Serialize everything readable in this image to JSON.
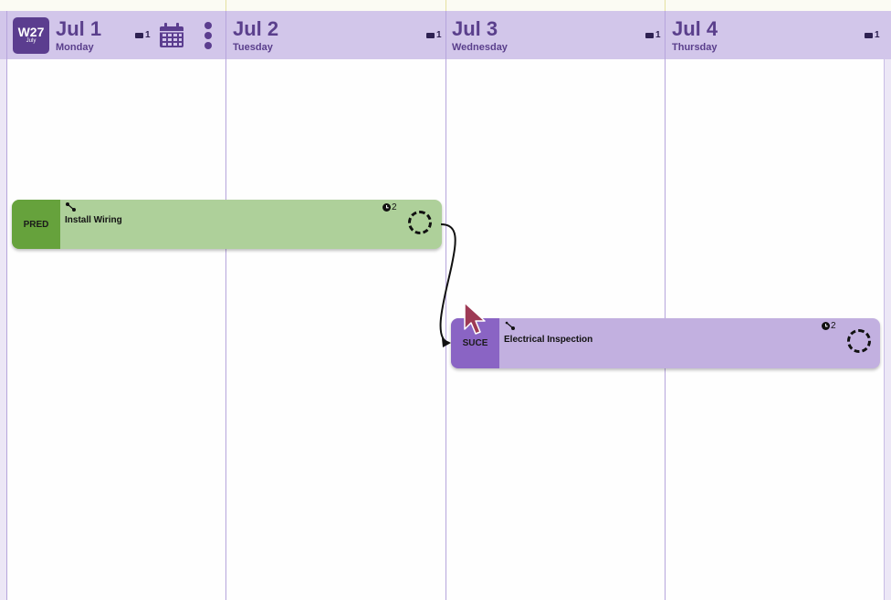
{
  "week": {
    "number": "W27",
    "month": "July"
  },
  "days": [
    {
      "date": "Jul 1",
      "weekday": "Monday",
      "count": "1"
    },
    {
      "date": "Jul 2",
      "weekday": "Tuesday",
      "count": "1"
    },
    {
      "date": "Jul 3",
      "weekday": "Wednesday",
      "count": "1"
    },
    {
      "date": "Jul 4",
      "weekday": "Thursday",
      "count": "1"
    }
  ],
  "events": {
    "predecessor": {
      "tag": "PRED",
      "title": "Install Wiring",
      "duration": "2"
    },
    "successor": {
      "tag": "SUCE",
      "title": "Electrical Inspection",
      "duration": "2"
    }
  },
  "colors": {
    "header_bg": "#d2c6ea",
    "accent": "#5b3d8f",
    "pred_tag": "#66a23c",
    "pred_body": "#aed09a",
    "suce_tag": "#8a64c4",
    "suce_body": "#c2b0e0"
  },
  "icons": [
    "calendar-icon",
    "more-vertical-icon",
    "camera-icon",
    "link-icon",
    "clock-icon",
    "drag-ring-icon",
    "cursor-icon"
  ]
}
